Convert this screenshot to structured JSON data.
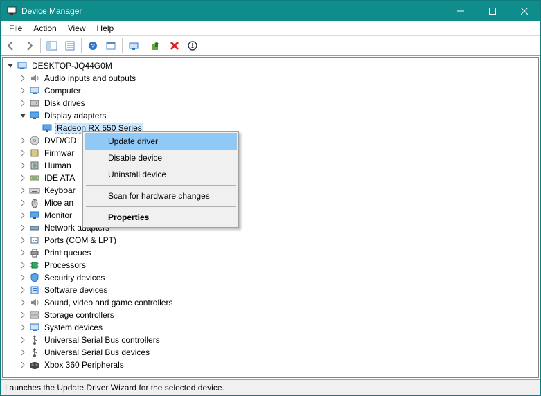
{
  "title": "Device Manager",
  "menu": {
    "file": "File",
    "action": "Action",
    "view": "View",
    "help": "Help"
  },
  "root": "DESKTOP-JQ44G0M",
  "categories": [
    {
      "label": "Audio inputs and outputs"
    },
    {
      "label": "Computer"
    },
    {
      "label": "Disk drives"
    },
    {
      "label": "Display adapters",
      "expanded": true,
      "child": "Radeon RX 550 Series"
    },
    {
      "label": "DVD/CD"
    },
    {
      "label": "Firmwar"
    },
    {
      "label": "Human "
    },
    {
      "label": "IDE ATA"
    },
    {
      "label": "Keyboar"
    },
    {
      "label": "Mice an"
    },
    {
      "label": "Monitor"
    },
    {
      "label": "Network adapters"
    },
    {
      "label": "Ports (COM & LPT)"
    },
    {
      "label": "Print queues"
    },
    {
      "label": "Processors"
    },
    {
      "label": "Security devices"
    },
    {
      "label": "Software devices"
    },
    {
      "label": "Sound, video and game controllers"
    },
    {
      "label": "Storage controllers"
    },
    {
      "label": "System devices"
    },
    {
      "label": "Universal Serial Bus controllers"
    },
    {
      "label": "Universal Serial Bus devices"
    },
    {
      "label": "Xbox 360 Peripherals"
    }
  ],
  "context_menu": {
    "update": "Update driver",
    "disable": "Disable device",
    "uninstall": "Uninstall device",
    "scan": "Scan for hardware changes",
    "properties": "Properties"
  },
  "status": "Launches the Update Driver Wizard for the selected device."
}
